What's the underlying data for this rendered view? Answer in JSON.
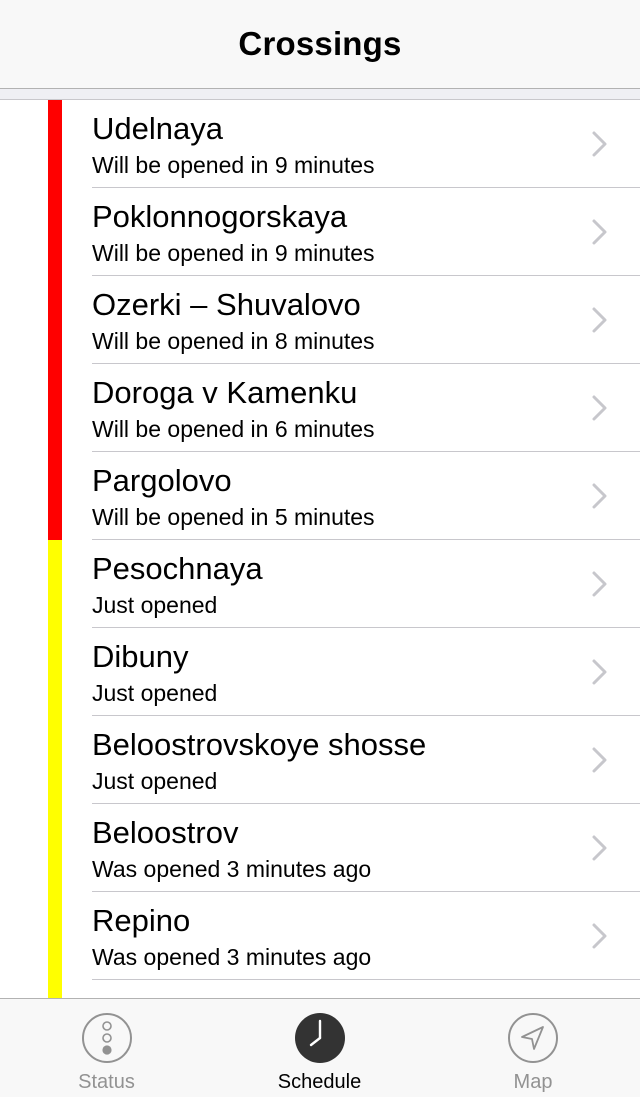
{
  "nav": {
    "title": "Crossings"
  },
  "colors": {
    "closed": "#ff0000",
    "open": "#ffff00",
    "tab_active": "#000000",
    "tab_inactive": "#929292"
  },
  "crossings": [
    {
      "name": "Udelnaya",
      "status": "Will be opened in 9 minutes",
      "state": "closed"
    },
    {
      "name": "Poklonnogorskaya",
      "status": "Will be opened in 9 minutes",
      "state": "closed"
    },
    {
      "name": "Ozerki – Shuvalovo",
      "status": "Will be opened in 8 minutes",
      "state": "closed"
    },
    {
      "name": "Doroga v Kamenku",
      "status": "Will be opened in 6 minutes",
      "state": "closed"
    },
    {
      "name": "Pargolovo",
      "status": "Will be opened in 5 minutes",
      "state": "closed"
    },
    {
      "name": "Pesochnaya",
      "status": "Just opened",
      "state": "open"
    },
    {
      "name": "Dibuny",
      "status": "Just opened",
      "state": "open"
    },
    {
      "name": "Beloostrovskoye shosse",
      "status": "Just opened",
      "state": "open"
    },
    {
      "name": "Beloostrov",
      "status": "Was opened 3 minutes ago",
      "state": "open"
    },
    {
      "name": "Repino",
      "status": "Was opened 3 minutes ago",
      "state": "open"
    },
    {
      "name": "",
      "status": "",
      "state": "open"
    }
  ],
  "tabs": [
    {
      "id": "status",
      "label": "Status",
      "icon": "traffic-light-icon",
      "active": false
    },
    {
      "id": "schedule",
      "label": "Schedule",
      "icon": "clock-icon",
      "active": true
    },
    {
      "id": "map",
      "label": "Map",
      "icon": "location-arrow-icon",
      "active": false
    }
  ]
}
